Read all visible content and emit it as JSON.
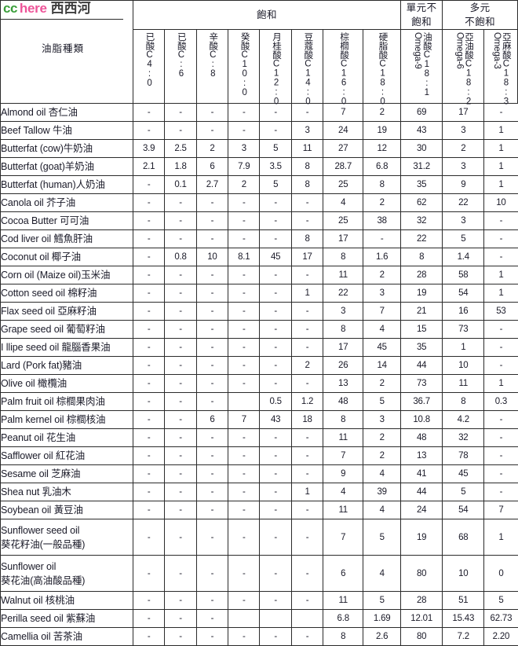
{
  "logo": {
    "part1": "cc",
    "part2": "here",
    "part3": "西西河",
    "color1": "#3a9e3a",
    "color2": "#ee5599",
    "color3": "#3d3d3d"
  },
  "table": {
    "row_label_header": "油脂種類",
    "group_headers": [
      {
        "label": "飽和",
        "span": 8
      },
      {
        "label": "單元不\n飽和",
        "line1": "單元不",
        "line2": "飽和",
        "span": 1
      },
      {
        "label": "多元\n不飽和",
        "line1": "多元",
        "line2": "不飽和",
        "span": 2
      }
    ],
    "columns": [
      {
        "cn": "已酸C4:0",
        "main": "已酸C4:0",
        "sub": ""
      },
      {
        "cn": "已酸C:6",
        "main": "已酸C:6",
        "sub": ""
      },
      {
        "cn": "辛酸C:8",
        "main": "辛酸C:8",
        "sub": ""
      },
      {
        "cn": "癸酸C10:0",
        "main": "癸酸C10:0",
        "sub": ""
      },
      {
        "cn": "月桂酸C12:0",
        "main": "月桂酸C12:0",
        "sub": ""
      },
      {
        "cn": "豆蔻酸C14:0",
        "main": "豆蔻酸C14:0",
        "sub": ""
      },
      {
        "cn": "棕櫚酸C16:0",
        "main": "棕櫚酸C16:0",
        "sub": ""
      },
      {
        "cn": "硬脂酸C18:0",
        "main": "硬脂酸C18:0",
        "sub": ""
      },
      {
        "cn": "油酸C18:1",
        "main": "油酸C18:1",
        "sub": "Omega-9"
      },
      {
        "cn": "亞油酸C18:2",
        "main": "亞油酸C18:2",
        "sub": "Omega-6"
      },
      {
        "cn": "亞麻酸C18:3",
        "main": "亞麻酸C18:3",
        "sub": "Omega-3"
      }
    ],
    "rows": [
      {
        "name": "Almond oil 杏仁油",
        "name2": "",
        "tall": false,
        "values": [
          "-",
          "-",
          "-",
          "-",
          "-",
          "-",
          "7",
          "2",
          "69",
          "17",
          "-"
        ]
      },
      {
        "name": "Beef Tallow 牛油",
        "name2": "",
        "tall": false,
        "values": [
          "-",
          "-",
          "-",
          "-",
          "-",
          "3",
          "24",
          "19",
          "43",
          "3",
          "1"
        ]
      },
      {
        "name": "Butterfat (cow)牛奶油",
        "name2": "",
        "tall": false,
        "values": [
          "3.9",
          "2.5",
          "2",
          "3",
          "5",
          "11",
          "27",
          "12",
          "30",
          "2",
          "1"
        ]
      },
      {
        "name": "Butterfat (goat)羊奶油",
        "name2": "",
        "tall": false,
        "values": [
          "2.1",
          "1.8",
          "6",
          "7.9",
          "3.5",
          "8",
          "28.7",
          "6.8",
          "31.2",
          "3",
          "1"
        ]
      },
      {
        "name": "Butterfat (human)人奶油",
        "name2": "",
        "tall": false,
        "values": [
          "-",
          "0.1",
          "2.7",
          "2",
          "5",
          "8",
          "25",
          "8",
          "35",
          "9",
          "1"
        ]
      },
      {
        "name": "Canola oil 芥子油",
        "name2": "",
        "tall": false,
        "values": [
          "-",
          "-",
          "-",
          "-",
          "-",
          "-",
          "4",
          "2",
          "62",
          "22",
          "10"
        ]
      },
      {
        "name": "Cocoa Butter 可可油",
        "name2": "",
        "tall": false,
        "values": [
          "-",
          "-",
          "-",
          "-",
          "-",
          "-",
          "25",
          "38",
          "32",
          "3",
          "-"
        ]
      },
      {
        "name": "Cod liver oil 鱈魚肝油",
        "name2": "",
        "tall": false,
        "values": [
          "-",
          "-",
          "-",
          "-",
          "-",
          "8",
          "17",
          "-",
          "22",
          "5",
          "-"
        ]
      },
      {
        "name": "Coconut oil 椰子油",
        "name2": "",
        "tall": false,
        "values": [
          "-",
          "0.8",
          "10",
          "8.1",
          "45",
          "17",
          "8",
          "1.6",
          "8",
          "1.4",
          "-"
        ]
      },
      {
        "name": "Corn oil (Maize oil)玉米油",
        "name2": "",
        "tall": false,
        "values": [
          "-",
          "-",
          "-",
          "-",
          "-",
          "-",
          "11",
          "2",
          "28",
          "58",
          "1"
        ]
      },
      {
        "name": "Cotton seed oil 棉籽油",
        "name2": "",
        "tall": false,
        "values": [
          "-",
          "-",
          "-",
          "-",
          "-",
          "1",
          "22",
          "3",
          "19",
          "54",
          "1"
        ]
      },
      {
        "name": "Flax seed oil 亞麻籽油",
        "name2": "",
        "tall": false,
        "values": [
          "-",
          "-",
          "-",
          "-",
          "-",
          "-",
          "3",
          "7",
          "21",
          "16",
          "53"
        ]
      },
      {
        "name": "Grape seed oil 葡萄籽油",
        "name2": "",
        "tall": false,
        "values": [
          "-",
          "-",
          "-",
          "-",
          "-",
          "-",
          "8",
          "4",
          "15",
          "73",
          "-"
        ]
      },
      {
        "name": "I llipe seed oil 龍腦香果油",
        "name2": "",
        "tall": false,
        "values": [
          "-",
          "-",
          "-",
          "-",
          "-",
          "-",
          "17",
          "45",
          "35",
          "1",
          "-"
        ]
      },
      {
        "name": "Lard (Pork fat)豬油",
        "name2": "",
        "tall": false,
        "values": [
          "-",
          "-",
          "-",
          "-",
          "-",
          "2",
          "26",
          "14",
          "44",
          "10",
          "-"
        ]
      },
      {
        "name": "Olive oil 橄欖油",
        "name2": "",
        "tall": false,
        "values": [
          "-",
          "-",
          "-",
          "-",
          "-",
          "-",
          "13",
          "2",
          "73",
          "11",
          "1"
        ]
      },
      {
        "name": "Palm fruit oil 棕櫚果肉油",
        "name2": "",
        "tall": false,
        "values": [
          "-",
          "-",
          "-",
          "",
          "0.5",
          "1.2",
          "48",
          "5",
          "36.7",
          "8",
          "0.3"
        ]
      },
      {
        "name": "Palm kernel oil 棕櫚核油",
        "name2": "",
        "tall": false,
        "values": [
          "-",
          "-",
          "6",
          "7",
          "43",
          "18",
          "8",
          "3",
          "10.8",
          "4.2",
          "-"
        ]
      },
      {
        "name": "Peanut oil 花生油",
        "name2": "",
        "tall": false,
        "values": [
          "-",
          "-",
          "-",
          "-",
          "-",
          "-",
          "11",
          "2",
          "48",
          "32",
          "-"
        ]
      },
      {
        "name": "Safflower oil 紅花油",
        "name2": "",
        "tall": false,
        "values": [
          "-",
          "-",
          "-",
          "-",
          "-",
          "-",
          "7",
          "2",
          "13",
          "78",
          "-"
        ]
      },
      {
        "name": "Sesame oil 芝麻油",
        "name2": "",
        "tall": false,
        "values": [
          "-",
          "-",
          "-",
          "-",
          "-",
          "-",
          "9",
          "4",
          "41",
          "45",
          "-"
        ]
      },
      {
        "name": "Shea nut 乳油木",
        "name2": "",
        "tall": false,
        "values": [
          "-",
          "-",
          "-",
          "-",
          "-",
          "1",
          "4",
          "39",
          "44",
          "5",
          "-"
        ]
      },
      {
        "name": "Soybean oil 黃豆油",
        "name2": "",
        "tall": false,
        "values": [
          "-",
          "-",
          "-",
          "-",
          "-",
          "-",
          "11",
          "4",
          "24",
          "54",
          "7"
        ]
      },
      {
        "name": "Sunflower seed oil",
        "name2": "葵花籽油(一般品種)",
        "tall": true,
        "values": [
          "-",
          "-",
          "-",
          "-",
          "-",
          "-",
          "7",
          "5",
          "19",
          "68",
          "1"
        ]
      },
      {
        "name": "Sunflower oil",
        "name2": "葵花油(高油酸品種)",
        "tall": true,
        "values": [
          "-",
          "-",
          "-",
          "-",
          "-",
          "-",
          "6",
          "4",
          "80",
          "10",
          "0"
        ]
      },
      {
        "name": "Walnut oil 核桃油",
        "name2": "",
        "tall": false,
        "values": [
          "-",
          "-",
          "-",
          "-",
          "-",
          "-",
          "11",
          "5",
          "28",
          "51",
          "5"
        ]
      },
      {
        "name": "Perilla seed oil 紫蘇油",
        "name2": "",
        "tall": false,
        "values": [
          "-",
          "-",
          "-",
          "",
          "",
          "",
          "6.8",
          "1.69",
          "12.01",
          "15.43",
          "62.73"
        ]
      },
      {
        "name": "Camellia oil 苦茶油",
        "name2": "",
        "tall": false,
        "values": [
          "-",
          "-",
          "-",
          "-",
          "-",
          "-",
          "8",
          "2.6",
          "80",
          "7.2",
          "2.20"
        ]
      }
    ]
  }
}
